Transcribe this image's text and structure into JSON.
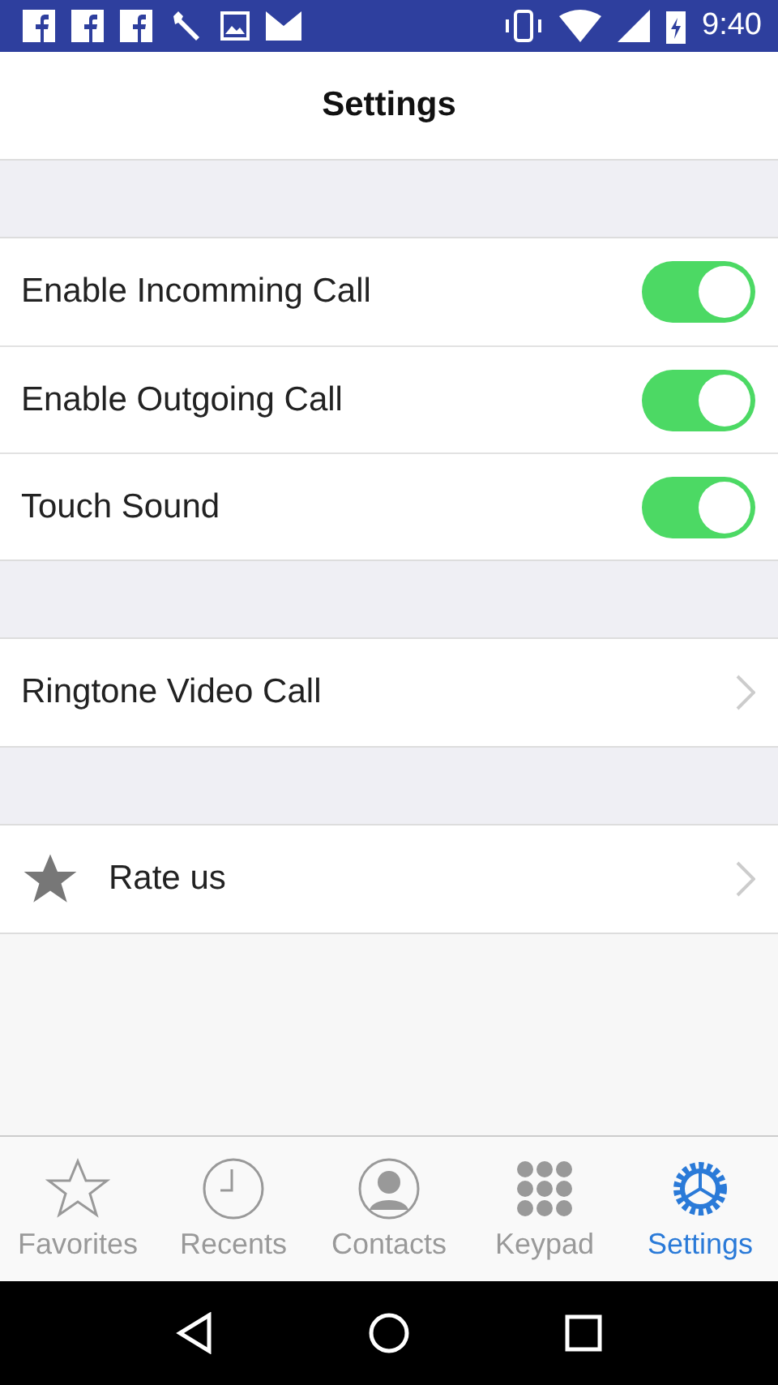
{
  "status_bar": {
    "time": "9:40"
  },
  "header": {
    "title": "Settings"
  },
  "sections": [
    {
      "rows": [
        {
          "kind": "toggle",
          "label": "Enable Incomming Call",
          "on": true
        },
        {
          "kind": "toggle",
          "label": "Enable Outgoing Call",
          "on": true
        },
        {
          "kind": "toggle",
          "label": "Touch Sound",
          "on": true
        }
      ]
    },
    {
      "rows": [
        {
          "kind": "link",
          "label": "Ringtone Video Call"
        }
      ]
    },
    {
      "rows": [
        {
          "kind": "rate",
          "label": "Rate us"
        }
      ]
    }
  ],
  "tabs": [
    {
      "label": "Favorites",
      "selected": false
    },
    {
      "label": "Recents",
      "selected": false
    },
    {
      "label": "Contacts",
      "selected": false
    },
    {
      "label": "Keypad",
      "selected": false
    },
    {
      "label": "Settings",
      "selected": true
    }
  ]
}
